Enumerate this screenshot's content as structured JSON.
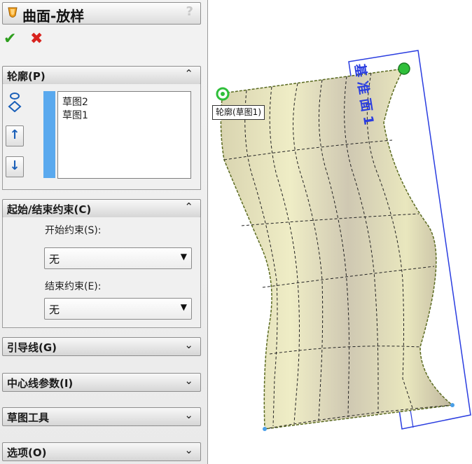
{
  "panel": {
    "title": "曲面-放样",
    "help": "?",
    "ok": "✔",
    "cancel": "✖"
  },
  "profiles": {
    "header": "轮廓(P)",
    "items": [
      "草图2",
      "草图1"
    ],
    "move_up": "↑",
    "move_down": "↓"
  },
  "constraints": {
    "header": "起始/结束约束(C)",
    "start_label": "开始约束(S):",
    "start_value": "无",
    "end_label": "结束约束(E):",
    "end_value": "无"
  },
  "collapsed_groups": {
    "guides": "引导线(G)",
    "centerline": "中心线参数(I)",
    "sketch_tools": "草图工具",
    "options": "选项(O)"
  },
  "chevrons": {
    "up": "≈",
    "down": "≈"
  },
  "graphics": {
    "callout": "轮廓(草图1)",
    "plane_label": "基准面1"
  },
  "colors": {
    "accent": "#5aa9ee",
    "surface": "#e6e3b8",
    "plane": "#2a3de0",
    "handle": "#2fbf3a"
  }
}
